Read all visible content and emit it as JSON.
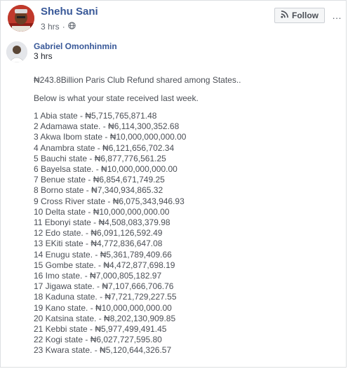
{
  "post": {
    "author": "Shehu Sani",
    "time": "3 hrs",
    "separator": "·",
    "follow_label": "Follow",
    "more_label": "…"
  },
  "comment": {
    "author": "Gabriel Omonhinmin",
    "time": "3 hrs",
    "intro": "₦243.8Billion Paris Club Refund shared among States..",
    "intro2": "Below is what your state received last week.",
    "states": [
      "1 Abia state - ₦5,715,765,871.48",
      "2 Adamawa state. - ₦6,114,300,352.68",
      "3 Akwa Ibom state - ₦10,000,000,000.00",
      "4 Anambra state - ₦6,121,656,702.34",
      "5 Bauchi state - ₦6,877,776,561.25",
      "6 Bayelsa state. - ₦10,000,000,000.00",
      "7 Benue state - ₦6,854,671,749.25",
      "8 Borno state - ₦7,340,934,865.32",
      "9 Cross River state - ₦6,075,343,946.93",
      "10 Delta state - ₦10,000,000,000.00",
      "11 Ebonyi state - ₦4,508,083,379.98",
      "12 Edo state. - ₦6,091,126,592.49",
      "13 EKiti state - ₦4,772,836,647.08",
      "14 Enugu state. - ₦5,361,789,409.66",
      "15 Gombe state. - ₦4,472,877,698.19",
      "16 Imo state. - ₦7,000,805,182.97",
      "17 Jigawa state. - ₦7,107,666,706.76",
      "18 Kaduna state. - ₦7,721,729,227.55",
      "19 Kano state. - ₦10,000,000,000.00",
      "20 Katsina state. - ₦8,202,130,909.85",
      "21 Kebbi state - ₦5,977,499,491.45",
      "22 Kogi state - ₦6,027,727,595.80",
      "23 Kwara state. - ₦5,120,644,326.57"
    ]
  },
  "colors": {
    "link": "#385898",
    "text": "#4b4f56",
    "meta": "#616770"
  },
  "icons": {
    "globe": "globe-icon",
    "rss": "rss-icon",
    "more": "more-options-icon"
  }
}
